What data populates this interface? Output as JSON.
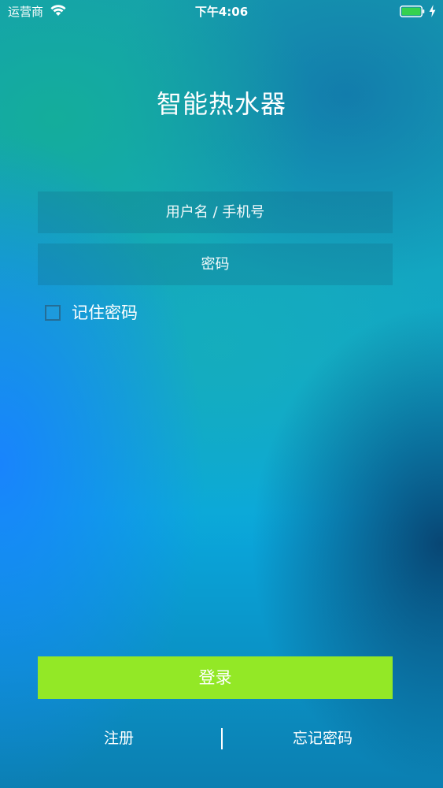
{
  "status_bar": {
    "carrier": "运营商",
    "time": "下午4:06",
    "icons": [
      "wifi-icon",
      "battery-icon",
      "charging-bolt-icon"
    ],
    "battery_color": "#35d14f"
  },
  "app": {
    "title": "智能热水器"
  },
  "login_form": {
    "username_placeholder": "用户名 / 手机号",
    "password_placeholder": "密码",
    "remember_label": "记住密码",
    "remember_checked": false,
    "login_label": "登录",
    "login_button_color": "#93e826"
  },
  "footer": {
    "register_label": "注册",
    "forgot_label": "忘记密码"
  }
}
